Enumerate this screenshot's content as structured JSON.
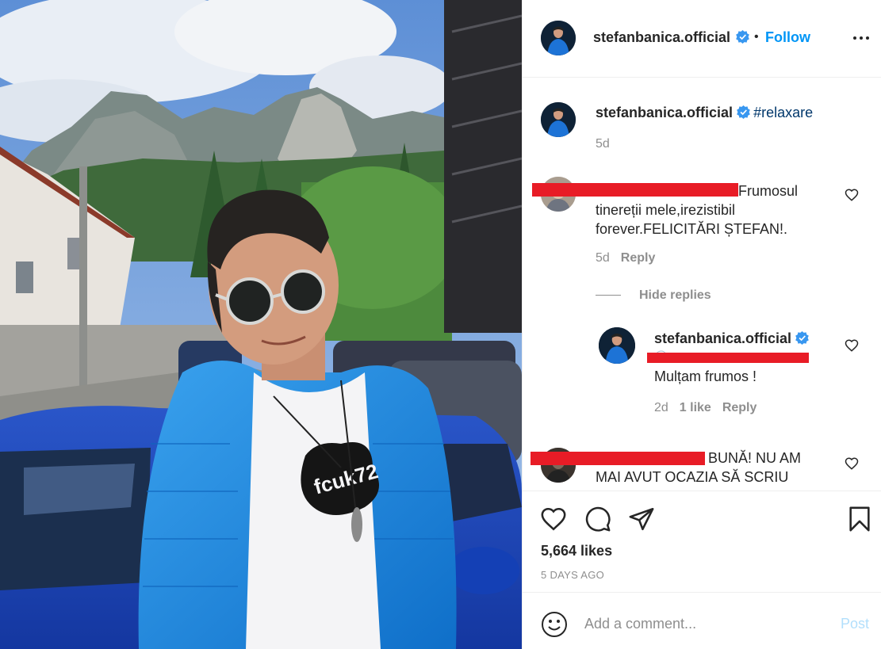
{
  "post": {
    "username": "stefanbanica.official",
    "follow_label": "Follow",
    "separator": "•",
    "caption": {
      "hashtag": "#relaxare",
      "time": "5d"
    },
    "comments": [
      {
        "text_lead": "Frumosul",
        "text_rest": "tinereții mele,irezistibil forever.FELICITĂRI ȘTEFAN!.",
        "time": "5d",
        "reply_label": "Reply"
      },
      {
        "text_lead": "BUNĂ! NU AM",
        "text_rest": "MAI AVUT OCAZIA SĂ SCRIU"
      }
    ],
    "hide_replies_label": "Hide replies",
    "reply": {
      "username": "stefanbanica.official",
      "mention": "@",
      "text": "Mulțam frumos !",
      "time": "2d",
      "likes_label": "1 like",
      "reply_label": "Reply"
    },
    "likes_label": "5,664 likes",
    "date_label": "5 DAYS AGO",
    "comment_box": {
      "placeholder": "Add a comment...",
      "post_label": "Post"
    }
  },
  "colors": {
    "link_blue": "#0095f6",
    "hashtag": "#00376b",
    "secondary_text": "#8e8e8e",
    "redaction": "#e81c26",
    "post_disabled": "#b2dffc"
  },
  "icons": [
    "verified-badge-icon",
    "more-options-icon",
    "heart-icon",
    "comment-icon",
    "share-icon",
    "bookmark-icon",
    "emoji-icon"
  ]
}
